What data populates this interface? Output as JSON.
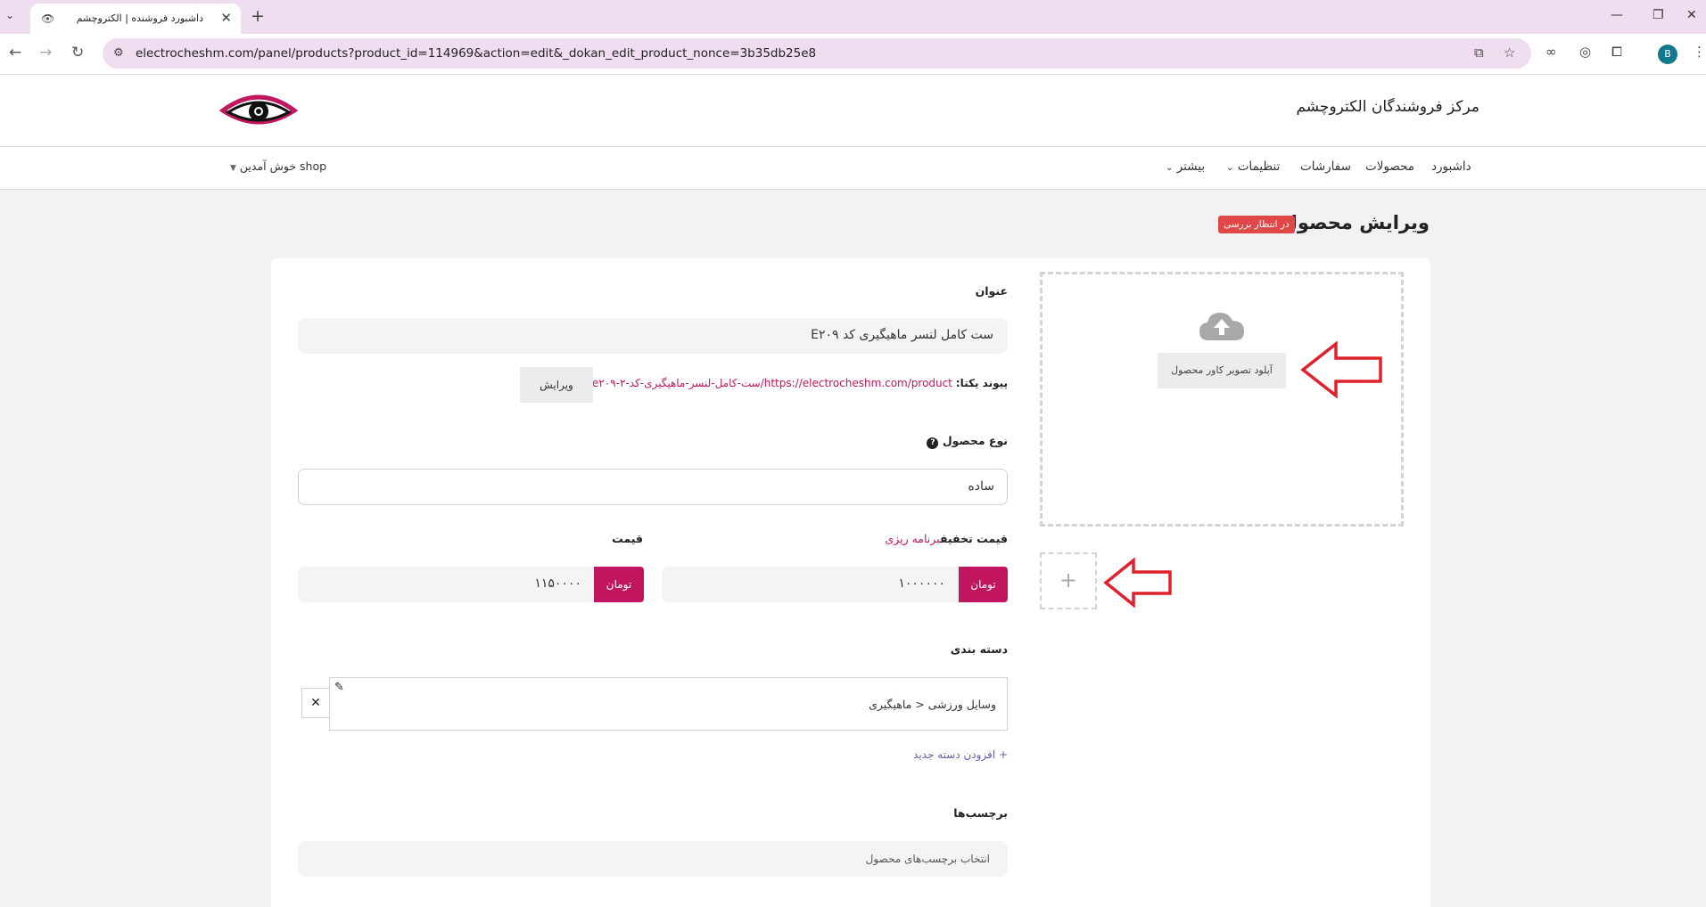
{
  "browser": {
    "tab_title": "داشبورد فروشنده | الکتروچشم",
    "url": "electrocheshm.com/panel/products?product_id=114969&action=edit&_dokan_edit_product_nonce=3b35db25e8",
    "profile_initial": "B"
  },
  "site": {
    "name": "مرکز فروشندگان الکتروچشم"
  },
  "nav": {
    "items": [
      "داشبورد",
      "محصولات",
      "سفارشات",
      "تنظیمات",
      "بیشتر"
    ],
    "welcome": "shop خوش آمدین"
  },
  "page": {
    "title": "ویرایش محصول",
    "status_badge": "در انتظار بررسی"
  },
  "form": {
    "title_label": "عنوان",
    "title_value": "ست کامل لنسر ماهیگیری کد E۲۰۹",
    "permalink_label": "پیوند یکتا:",
    "permalink_base": "https://electrocheshm.com/product/",
    "permalink_slug": "ست-کامل-لنسر-ماهیگیری-کد-e۲۰۹-۲",
    "permalink_edit": "ویرایش",
    "type_label": "نوع محصول",
    "type_value": "ساده",
    "sale_label": "قیمت تخفیف",
    "schedule_link": "برنامه ریزی",
    "sale_value": "۱۰۰۰۰۰۰",
    "price_label": "قیمت",
    "price_value": "۱۱۵۰۰۰۰",
    "currency": "تومان",
    "category_label": "دسته بندی",
    "category_value": "وسایل ورزشی < ماهیگیری",
    "add_category": "+ افزودن دسته جدید",
    "tags_label": "برچسب‌ها",
    "tags_placeholder": "انتخاب برچسب‌های محصول"
  },
  "upload": {
    "cover_button": "آپلود تصویر کاور محصول",
    "gallery_add": "+"
  },
  "colors": {
    "accent": "#c1165f",
    "annotation_arrow": "#e0202a",
    "badge": "#e04848"
  }
}
